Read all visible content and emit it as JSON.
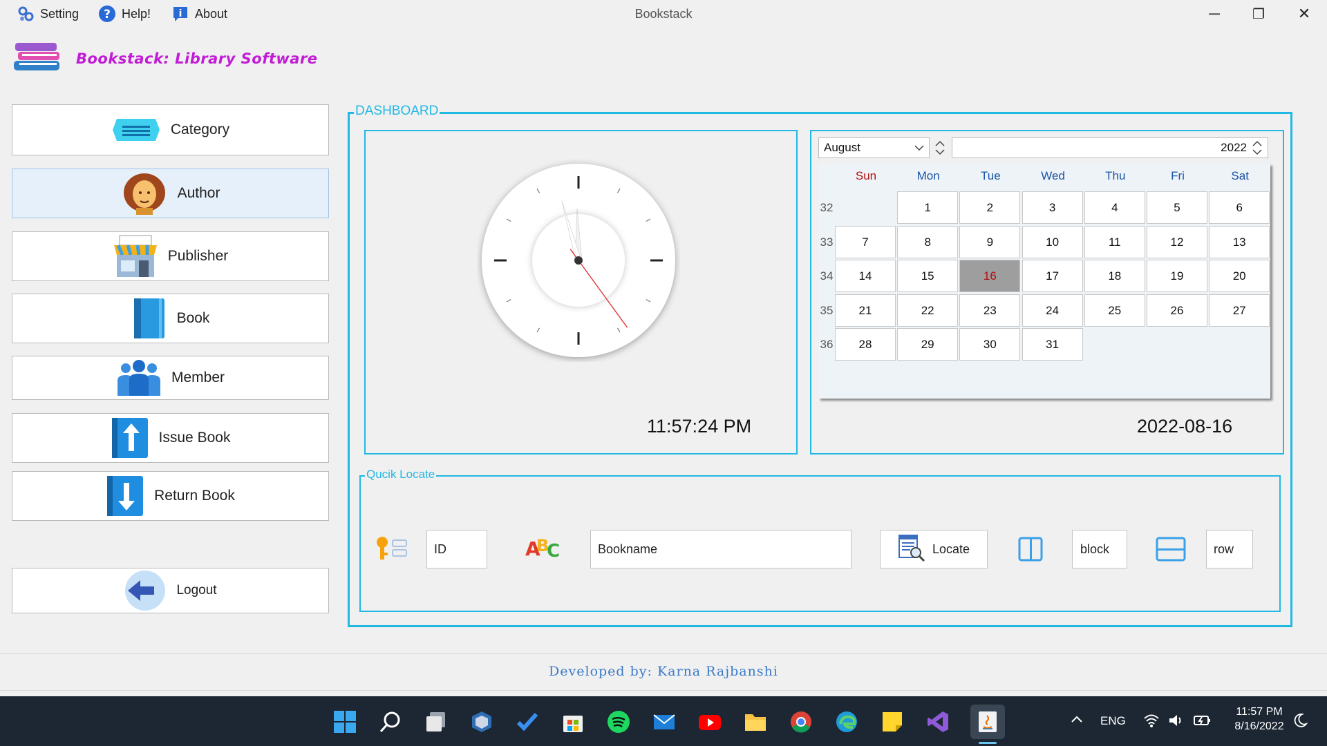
{
  "menu": {
    "setting": "Setting",
    "help": "Help!",
    "about": "About"
  },
  "window": {
    "title": "Bookstack",
    "minimize": "─",
    "maximize": "❐",
    "close": "✕"
  },
  "brand": {
    "title": "Bookstack: Library Software"
  },
  "sidebar": {
    "items": [
      {
        "label": "Category",
        "icon": "category-icon"
      },
      {
        "label": "Author",
        "icon": "author-icon",
        "active": true
      },
      {
        "label": "Publisher",
        "icon": "publisher-icon"
      },
      {
        "label": "Book",
        "icon": "book-icon"
      },
      {
        "label": "Member",
        "icon": "member-icon"
      },
      {
        "label": "Issue Book",
        "icon": "issue-book-icon"
      },
      {
        "label": "Return Book",
        "icon": "return-book-icon"
      }
    ],
    "logout": "Logout"
  },
  "dashboard": {
    "legend": "DASHBOARD",
    "time": "11:57:24 PM",
    "date": "2022-08-16",
    "clock": {
      "hour": 11,
      "minute": 57,
      "second": 24
    }
  },
  "calendar": {
    "month": "August",
    "year": "2022",
    "days": [
      "Sun",
      "Mon",
      "Tue",
      "Wed",
      "Thu",
      "Fri",
      "Sat"
    ],
    "weeks": [
      {
        "num": "32",
        "dates": [
          "",
          "1",
          "2",
          "3",
          "4",
          "5",
          "6"
        ]
      },
      {
        "num": "33",
        "dates": [
          "7",
          "8",
          "9",
          "10",
          "11",
          "12",
          "13"
        ]
      },
      {
        "num": "34",
        "dates": [
          "14",
          "15",
          "16",
          "17",
          "18",
          "19",
          "20"
        ]
      },
      {
        "num": "35",
        "dates": [
          "21",
          "22",
          "23",
          "24",
          "25",
          "26",
          "27"
        ]
      },
      {
        "num": "36",
        "dates": [
          "28",
          "29",
          "30",
          "31",
          "",
          "",
          ""
        ]
      }
    ],
    "selected": "16",
    "colors": {
      "sunday": "#b01010",
      "header": "#1a54a4"
    }
  },
  "quick_locate": {
    "legend": "Qucik Locate",
    "id_value": "ID",
    "bookname_value": "Bookname",
    "locate_label": "Locate",
    "block_label": "block",
    "row_label": "row"
  },
  "footer": {
    "text": "Developed by: Karna Rajbanshi"
  },
  "taskbar": {
    "lang": "ENG",
    "time": "11:57 PM",
    "date": "8/16/2022",
    "apps": [
      "windows-start-icon",
      "search-icon",
      "task-view-icon",
      "virtualbox-icon",
      "todo-icon",
      "store-icon",
      "spotify-icon",
      "mail-icon",
      "youtube-icon",
      "file-explorer-icon",
      "chrome-icon",
      "edge-icon",
      "sticky-notes-icon",
      "visual-studio-icon",
      "java-icon"
    ]
  },
  "accent": "#22b8e4"
}
